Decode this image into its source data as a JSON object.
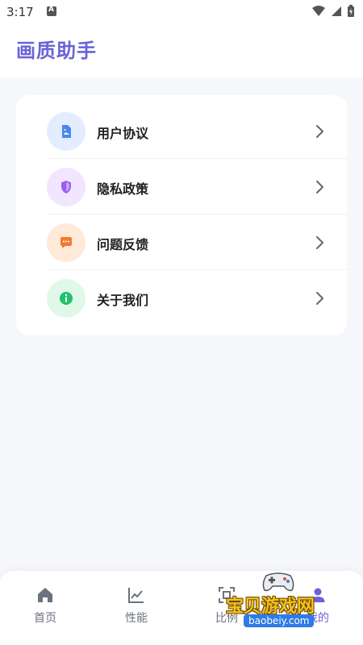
{
  "status": {
    "time": "3:17"
  },
  "header": {
    "title": "画质助手"
  },
  "menu": [
    {
      "label": "用户协议",
      "icon": "document-icon",
      "bg": "#e3edff",
      "fg": "#4b86f0"
    },
    {
      "label": "隐私政策",
      "icon": "shield-icon",
      "bg": "#f1e6ff",
      "fg": "#9a5cf1"
    },
    {
      "label": "问题反馈",
      "icon": "chat-icon",
      "bg": "#ffe9d9",
      "fg": "#f37a2f"
    },
    {
      "label": "关于我们",
      "icon": "info-icon",
      "bg": "#dff8e8",
      "fg": "#22c06b"
    }
  ],
  "nav": {
    "items": [
      {
        "label": "首页",
        "icon": "home-icon"
      },
      {
        "label": "性能",
        "icon": "chart-icon"
      },
      {
        "label": "比例",
        "icon": "scan-icon"
      },
      {
        "label": "我的",
        "icon": "user-icon"
      }
    ],
    "active_color": "#6a63d6",
    "inactive_color": "#6b7280"
  },
  "watermark": {
    "title": "宝贝游戏网",
    "url": "baobeiy.com"
  }
}
